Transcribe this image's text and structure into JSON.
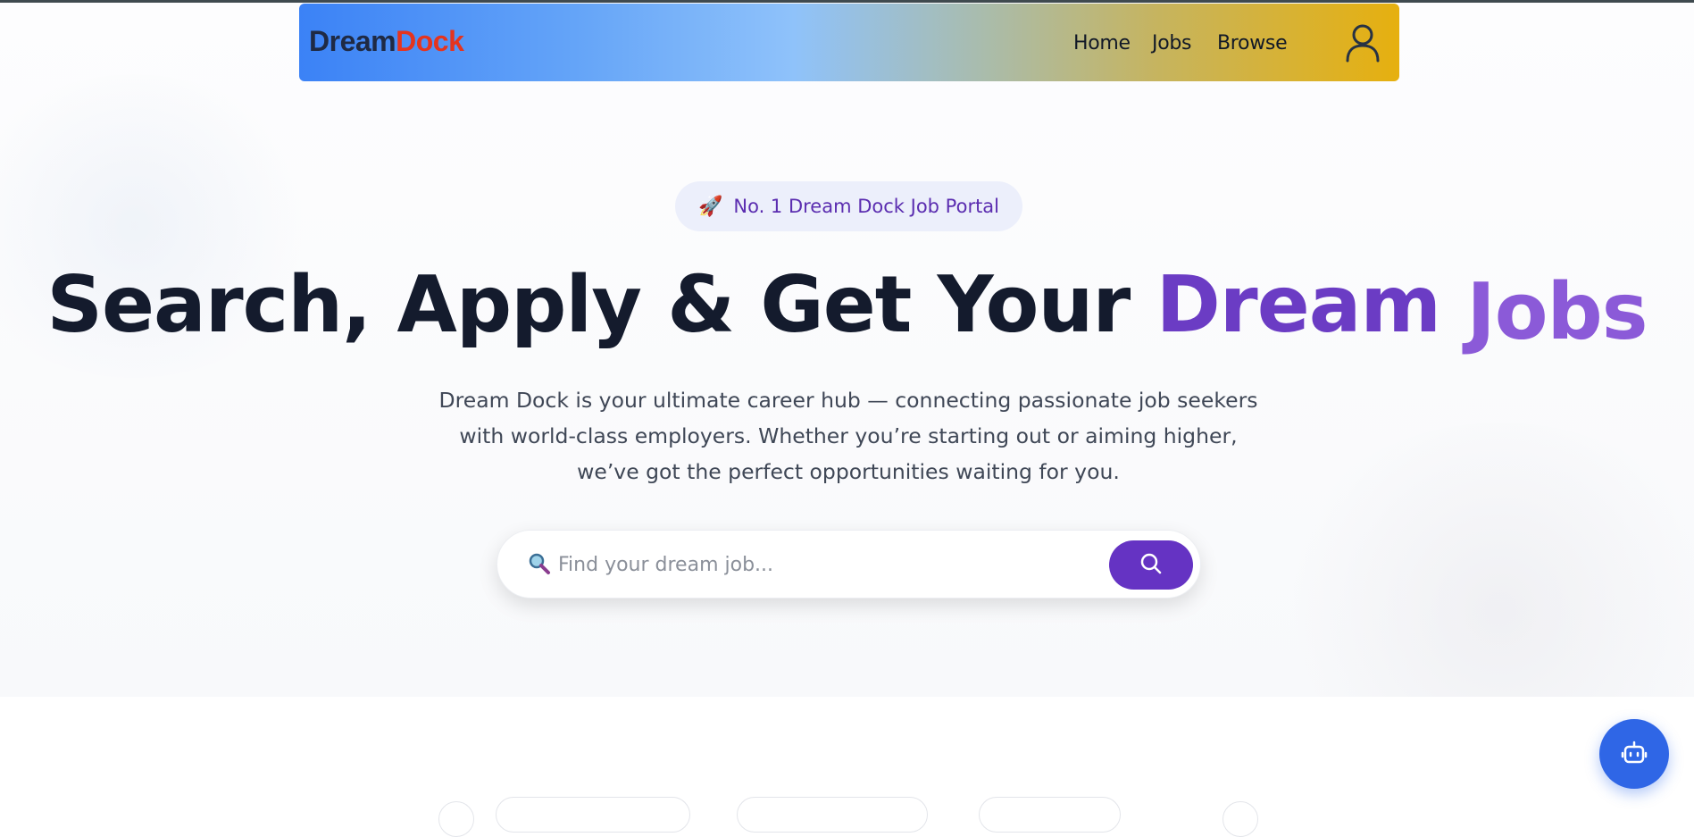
{
  "brand": {
    "part1": "Dream",
    "part2": "Dock"
  },
  "nav": {
    "items": [
      {
        "label": "Home"
      },
      {
        "label": "Jobs"
      },
      {
        "label": "Browse"
      }
    ]
  },
  "icons": {
    "profile": "user-icon",
    "search_prefix": "magnifier-emoji",
    "search_button": "search-icon",
    "chat": "robot-icon",
    "badge": "rocket-emoji"
  },
  "hero": {
    "badge_icon": "🚀",
    "badge_text": "No. 1 Dream Dock Job Portal",
    "headline_main": "Search, Apply & Get Your",
    "headline_dream": "Dream",
    "headline_jobs": "Jobs",
    "description": "Dream Dock is your ultimate career hub — connecting passionate job seekers with world-class employers. Whether you’re starting out or aiming higher, we’ve got the perfect opportunities waiting for you."
  },
  "search": {
    "icon": "🔍",
    "placeholder": "Find your dream job...",
    "value": ""
  },
  "colors": {
    "accent": "#6533c3",
    "brand_dark": "#1f2a44",
    "brand_red": "#e5341e",
    "chat_button": "#2f66e6",
    "nav_gradient_start": "#3b82f6",
    "nav_gradient_end": "#e6b00f"
  }
}
